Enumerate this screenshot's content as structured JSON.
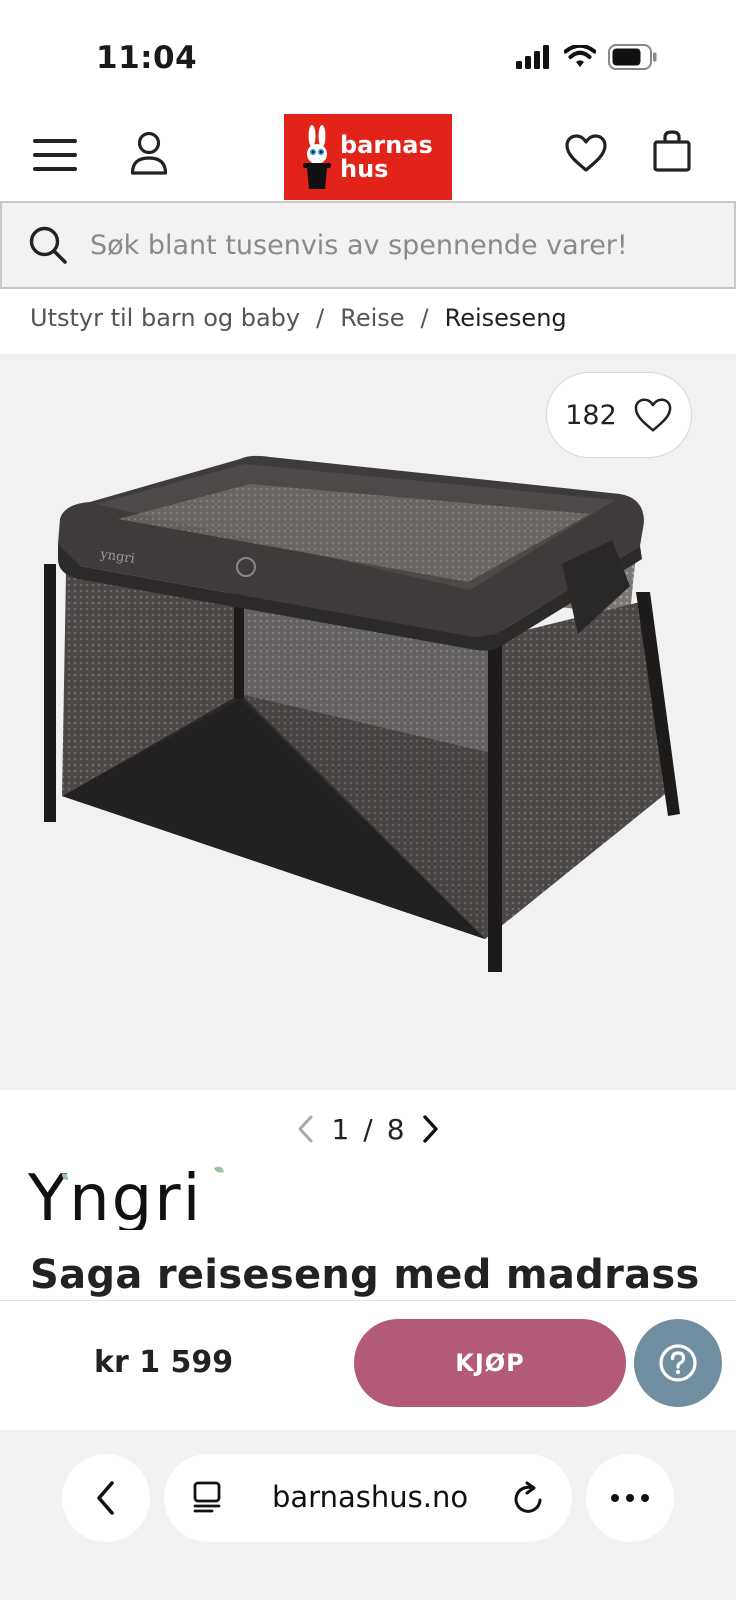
{
  "status_bar": {
    "time": "11:04"
  },
  "header": {
    "logo_line1": "barnas",
    "logo_line2": "hus"
  },
  "search": {
    "placeholder": "Søk blant tusenvis av spennende varer!"
  },
  "breadcrumb": {
    "items": [
      "Utstyr til barn og baby",
      "Reise",
      "Reiseseng"
    ],
    "separator": "/"
  },
  "gallery": {
    "favorites_count": "182",
    "pager_current": "1",
    "pager_separator": "/",
    "pager_total": "8"
  },
  "product": {
    "brand": "Yngri",
    "title": "Saga reiseseng med madrass",
    "price": "kr 1 599",
    "buy_label": "KJØP"
  },
  "browser": {
    "url": "barnashus.no"
  },
  "colors": {
    "brand_red": "#e2231a",
    "buy_button": "#b25a78",
    "help_button": "#6f8fa0"
  },
  "icons": [
    "menu-icon",
    "user-icon",
    "heart-icon",
    "bag-icon",
    "search-icon",
    "chevron-left-icon",
    "chevron-right-icon",
    "question-icon",
    "tabs-icon",
    "reload-icon",
    "more-icon",
    "signal-icon",
    "wifi-icon",
    "battery-icon"
  ]
}
